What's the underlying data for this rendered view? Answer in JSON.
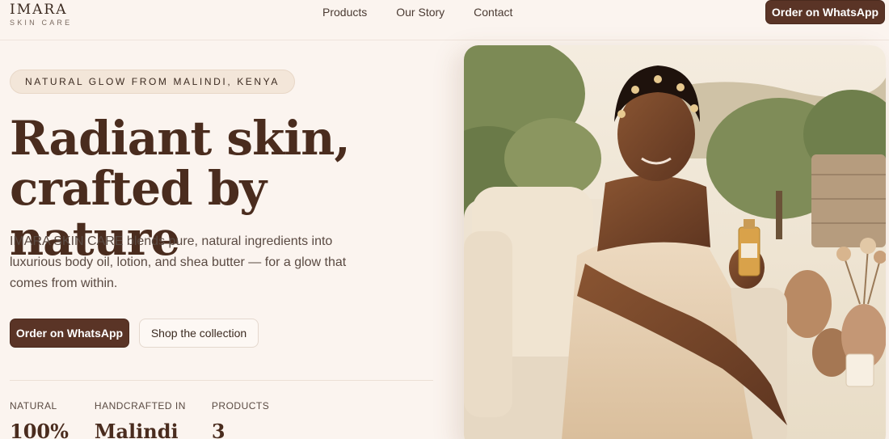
{
  "brand": {
    "name": "IMARA",
    "tagline": "SKIN CARE"
  },
  "nav": {
    "items": [
      "Products",
      "Our Story",
      "Contact"
    ]
  },
  "header": {
    "cta_label": "Order on WhatsApp"
  },
  "hero": {
    "eyebrow": "NATURAL GLOW FROM MALINDI, KENYA",
    "headline_line1": "Radiant skin,",
    "headline_line2": "crafted by nature",
    "description": "IMARA SKIN CARE blends pure, natural ingredients into luxurious body oil, lotion, and shea butter — for a glow that comes from within.",
    "primary_cta": "Order on WhatsApp",
    "secondary_cta": "Shop the collection",
    "image_alt": "Woman applying body oil outdoors",
    "stats": [
      {
        "label": "NATURAL",
        "value": "100%"
      },
      {
        "label": "HANDCRAFTED IN",
        "value": "Malindi"
      },
      {
        "label": "PRODUCTS",
        "value": "3"
      }
    ]
  },
  "colors": {
    "brand_dark": "#5a3426",
    "background": "#fbf4ef",
    "headline": "#4a2c1e"
  }
}
